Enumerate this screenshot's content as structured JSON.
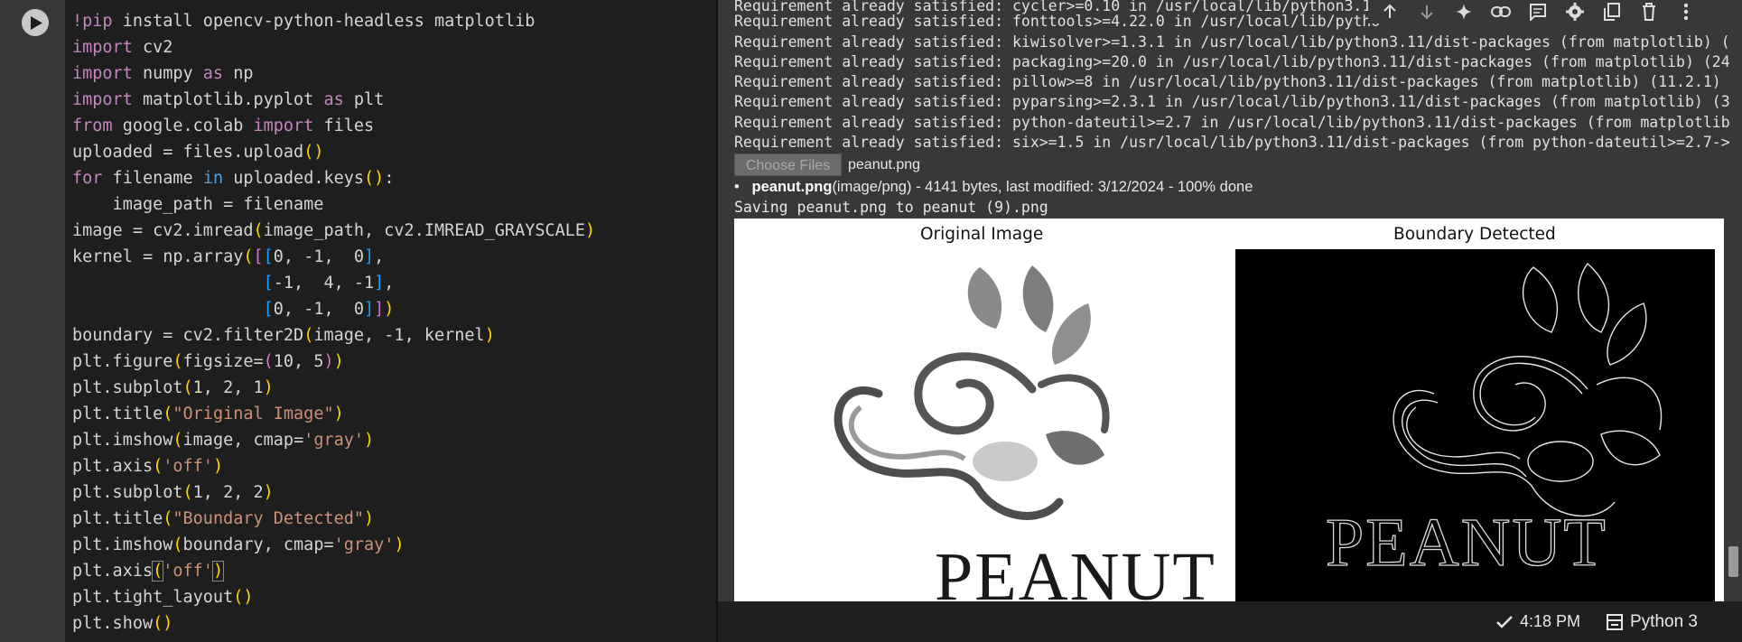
{
  "code": {
    "lines": [
      "!pip install opencv-python-headless matplotlib",
      "import cv2",
      "import numpy as np",
      "import matplotlib.pyplot as plt",
      "from google.colab import files",
      "uploaded = files.upload()",
      "for filename in uploaded.keys():",
      "    image_path = filename",
      "image = cv2.imread(image_path, cv2.IMREAD_GRAYSCALE)",
      "kernel = np.array([[0, -1,  0],",
      "                   [-1,  4, -1],",
      "                   [0, -1,  0]])",
      "boundary = cv2.filter2D(image, -1, kernel)",
      "plt.figure(figsize=(10, 5))",
      "plt.subplot(1, 2, 1)",
      "plt.title(\"Original Image\")",
      "plt.imshow(image, cmap='gray')",
      "plt.axis('off')",
      "plt.subplot(1, 2, 2)",
      "plt.title(\"Boundary Detected\")",
      "plt.imshow(boundary, cmap='gray')",
      "plt.axis('off')",
      "plt.tight_layout()",
      "plt.show()"
    ]
  },
  "output": {
    "lines": [
      "Requirement already satisfied: cycler>=0.10 in /usr/local/lib/python3.11",
      "Requirement already satisfied: fonttools>=4.22.0 in /usr/local/lib/pytho",
      "Requirement already satisfied: kiwisolver>=1.3.1 in /usr/local/lib/python3.11/dist-packages (from matplotlib) (",
      "Requirement already satisfied: packaging>=20.0 in /usr/local/lib/python3.11/dist-packages (from matplotlib) (24",
      "Requirement already satisfied: pillow>=8 in /usr/local/lib/python3.11/dist-packages (from matplotlib) (11.2.1)",
      "Requirement already satisfied: pyparsing>=2.3.1 in /usr/local/lib/python3.11/dist-packages (from matplotlib) (3",
      "Requirement already satisfied: python-dateutil>=2.7 in /usr/local/lib/python3.11/dist-packages (from matplotlib",
      "Requirement already satisfied: six>=1.5 in /usr/local/lib/python3.11/dist-packages (from python-dateutil>=2.7->"
    ],
    "choose_files_label": "Choose Files",
    "chosen_file": "peanut.png",
    "file_name": "peanut.png",
    "file_details": "(image/png) - 4141 bytes, last modified: 3/12/2024 - 100% done",
    "saving_text": "Saving peanut.png to peanut (9).png",
    "figure": {
      "title_left": "Original Image",
      "title_right": "Boundary Detected",
      "logo_text": "PEANUT"
    }
  },
  "toolbar": {
    "icons": [
      "arrow-up-icon",
      "arrow-down-icon",
      "sparkle-icon",
      "link-icon",
      "comment-icon",
      "gear-icon",
      "mirror-cell-icon",
      "trash-icon",
      "more-vert-icon"
    ]
  },
  "status": {
    "time": "4:18 PM",
    "runtime": "Python 3"
  },
  "colors": {
    "editor_bg": "#1e1e1e",
    "output_bg": "#383838",
    "keyword": "#c586c0",
    "string": "#ce9178"
  }
}
